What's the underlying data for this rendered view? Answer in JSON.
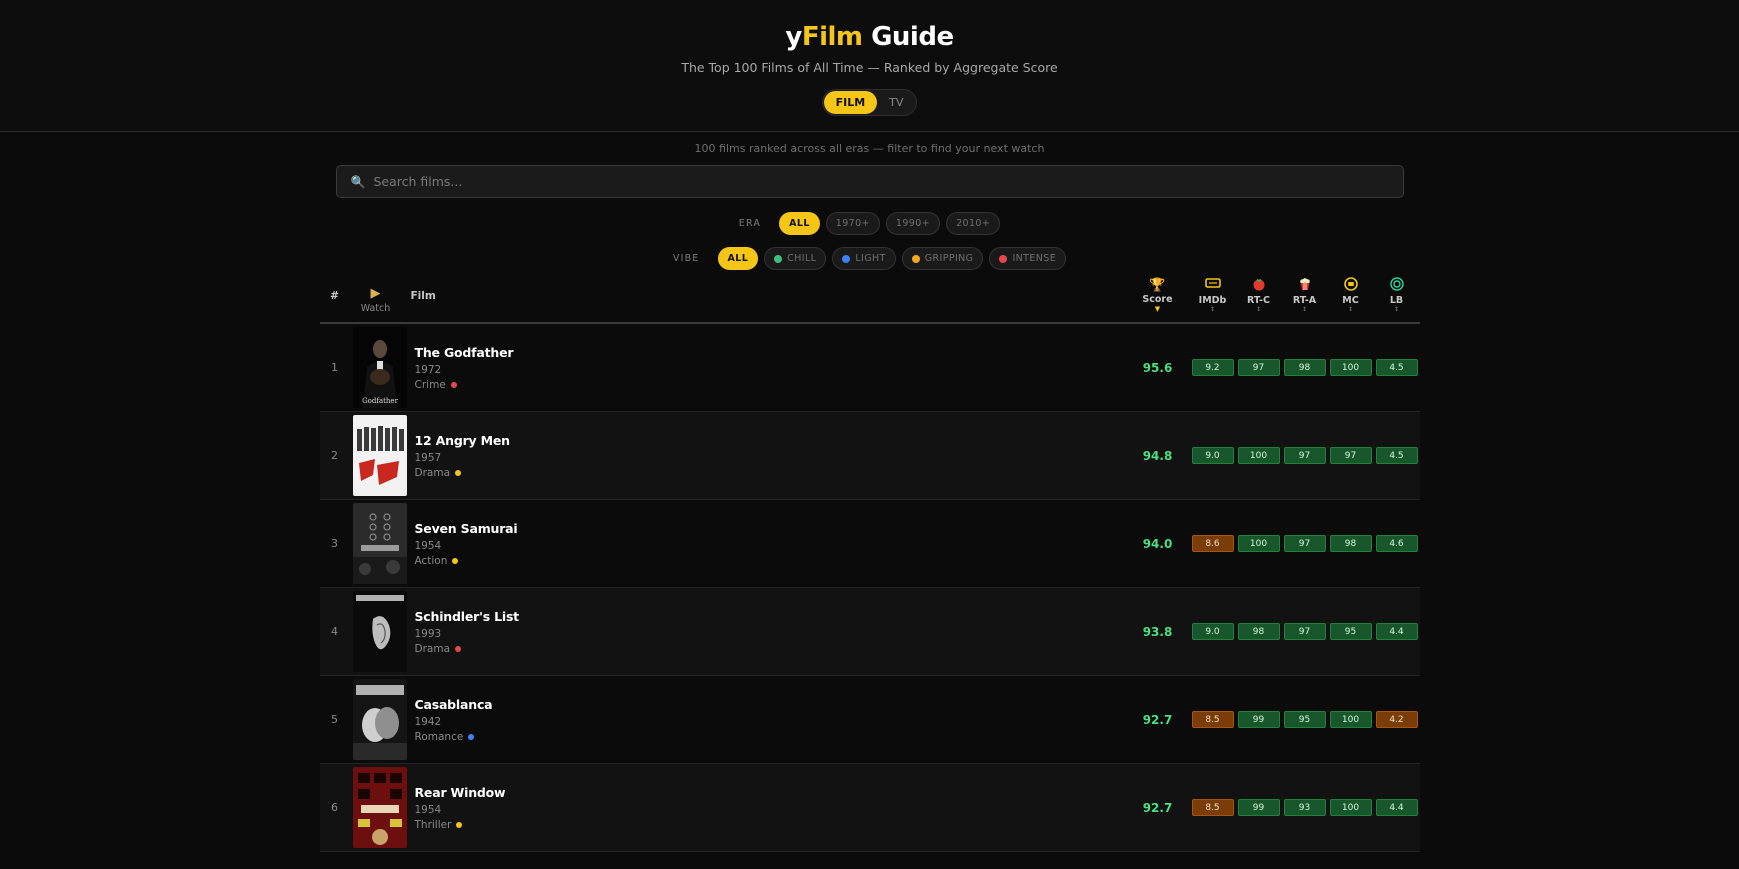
{
  "brand": {
    "prefix": "y",
    "accent": "Film",
    "suffix": " Guide"
  },
  "tagline": "The Top 100 Films of All Time — Ranked by Aggregate Score",
  "mode_toggle": [
    {
      "label": "FILM",
      "active": true
    },
    {
      "label": "TV",
      "active": false
    }
  ],
  "subtitle": "100 films ranked across all eras — filter to find your next watch",
  "search": {
    "placeholder": "Search films..."
  },
  "era_filter": {
    "label": "ERA",
    "options": [
      "ALL",
      "1970+",
      "1990+",
      "2010+"
    ]
  },
  "vibe_filter": {
    "label": "VIBE",
    "options": [
      {
        "label": "ALL",
        "color": null
      },
      {
        "label": "CHILL",
        "color": "#3fbf7f"
      },
      {
        "label": "LIGHT",
        "color": "#3b82f6"
      },
      {
        "label": "GRIPPING",
        "color": "#f5a623"
      },
      {
        "label": "INTENSE",
        "color": "#e5484d"
      }
    ]
  },
  "columns": {
    "rank": "#",
    "watch": "Watch",
    "film": "Film",
    "score": "Score",
    "sources": [
      "IMDb",
      "RT-C",
      "RT-A",
      "MC",
      "LB"
    ]
  },
  "colors": {
    "accent": "#f5c518",
    "good": "#17572b",
    "mid": "#7a3d0a",
    "score_text": "#4ade80"
  },
  "films": [
    {
      "rank": "1",
      "title": "The Godfather",
      "year": "1972",
      "genre": "Crime",
      "vibe_color": "#e5484d",
      "score": "95.6",
      "ratings": [
        "9.2",
        "97",
        "98",
        "100",
        "4.5"
      ],
      "tiers": [
        "g",
        "g",
        "g",
        "g",
        "g"
      ]
    },
    {
      "rank": "2",
      "title": "12 Angry Men",
      "year": "1957",
      "genre": "Drama",
      "vibe_color": "#f5c518",
      "score": "94.8",
      "ratings": [
        "9.0",
        "100",
        "97",
        "97",
        "4.5"
      ],
      "tiers": [
        "g",
        "g",
        "g",
        "g",
        "g"
      ]
    },
    {
      "rank": "3",
      "title": "Seven Samurai",
      "year": "1954",
      "genre": "Action",
      "vibe_color": "#f5c518",
      "score": "94.0",
      "ratings": [
        "8.6",
        "100",
        "97",
        "98",
        "4.6"
      ],
      "tiers": [
        "m",
        "g",
        "g",
        "g",
        "g"
      ]
    },
    {
      "rank": "4",
      "title": "Schindler's List",
      "year": "1993",
      "genre": "Drama",
      "vibe_color": "#e5484d",
      "score": "93.8",
      "ratings": [
        "9.0",
        "98",
        "97",
        "95",
        "4.4"
      ],
      "tiers": [
        "g",
        "g",
        "g",
        "g",
        "g"
      ]
    },
    {
      "rank": "5",
      "title": "Casablanca",
      "year": "1942",
      "genre": "Romance",
      "vibe_color": "#3b82f6",
      "score": "92.7",
      "ratings": [
        "8.5",
        "99",
        "95",
        "100",
        "4.2"
      ],
      "tiers": [
        "m",
        "g",
        "g",
        "g",
        "m"
      ]
    },
    {
      "rank": "6",
      "title": "Rear Window",
      "year": "1954",
      "genre": "Thriller",
      "vibe_color": "#f5c518",
      "score": "92.7",
      "ratings": [
        "8.5",
        "99",
        "93",
        "100",
        "4.4"
      ],
      "tiers": [
        "m",
        "g",
        "g",
        "g",
        "g"
      ]
    }
  ]
}
